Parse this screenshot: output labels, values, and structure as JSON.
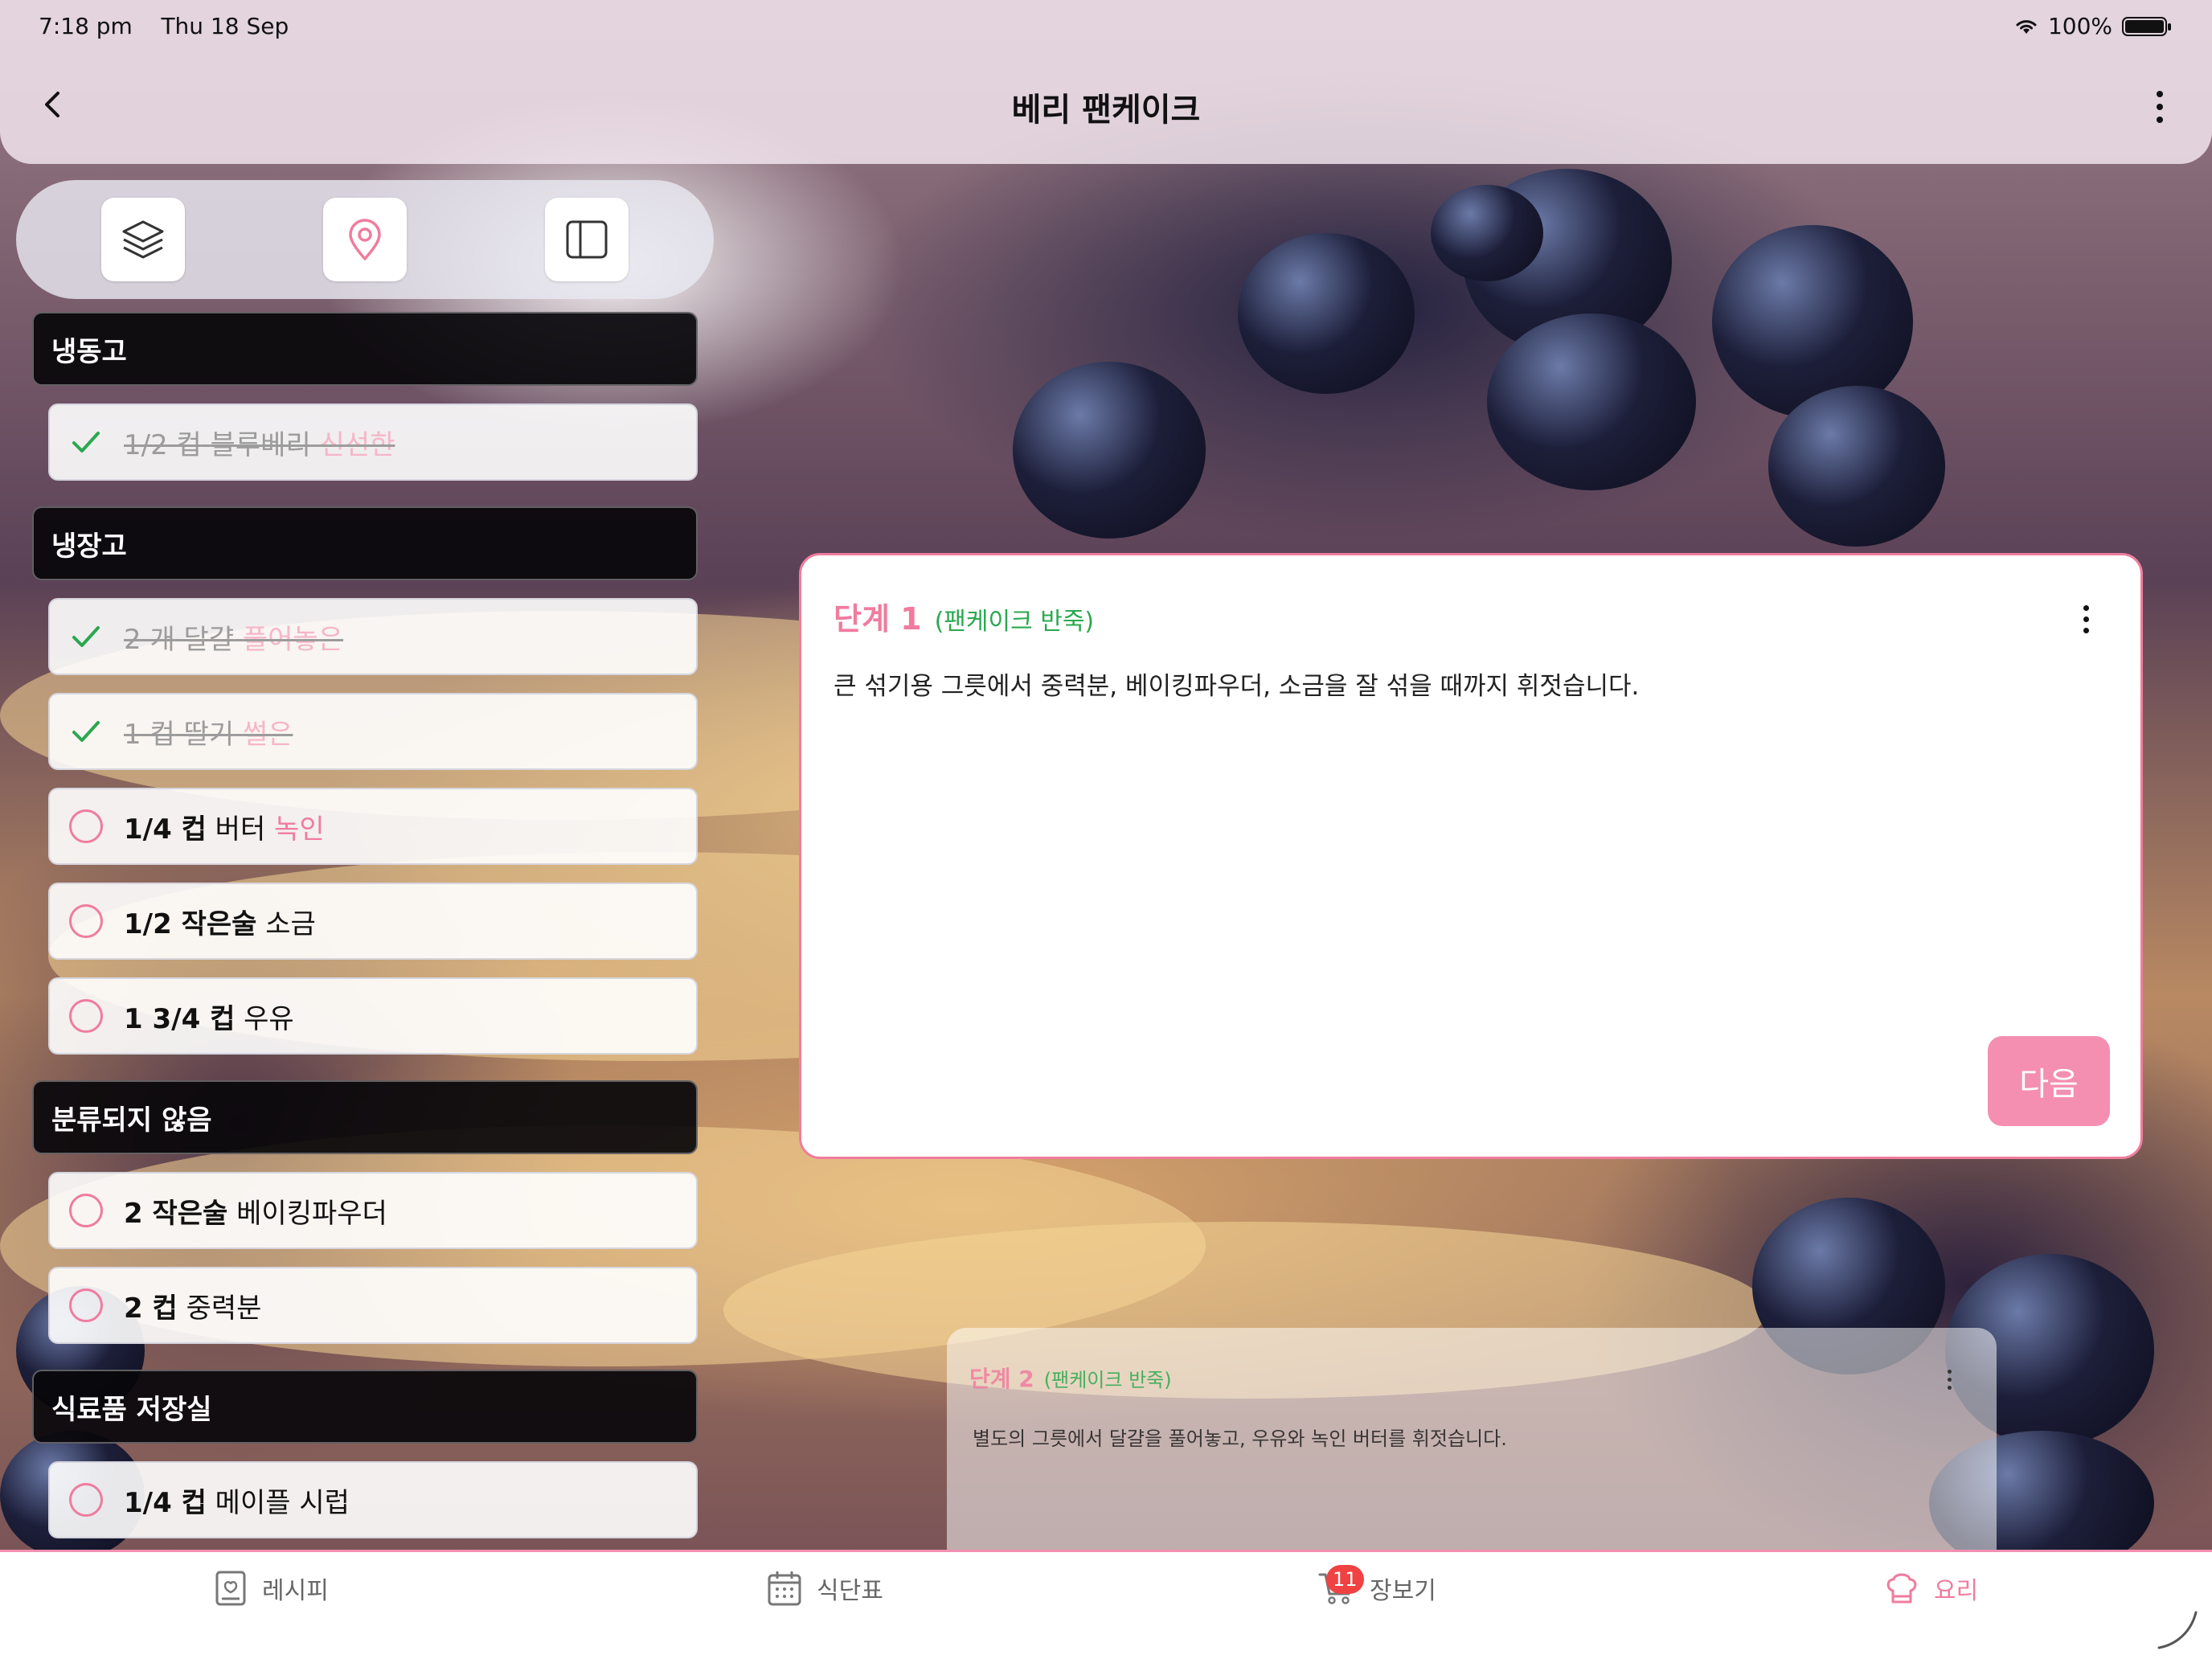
{
  "status_bar": {
    "time": "7:18 pm",
    "date": "Thu 18 Sep",
    "battery": "100%"
  },
  "header": {
    "title": "베리 팬케이크"
  },
  "toolbar": {
    "icons": [
      "layers-icon",
      "location-pin-icon",
      "sidebar-panel-icon"
    ]
  },
  "sections": [
    {
      "title": "냉동고",
      "items": [
        {
          "qty": "1/2 컵",
          "name": "블루베리",
          "note": "신선한",
          "done": true
        }
      ]
    },
    {
      "title": "냉장고",
      "items": [
        {
          "qty": "2 개",
          "name": "달걀",
          "note": "풀어놓은",
          "done": true
        },
        {
          "qty": "1 컵",
          "name": "딸기",
          "note": "썰은",
          "done": true
        },
        {
          "qty": "1/4 컵",
          "name": "버터",
          "note": "녹인",
          "done": false
        },
        {
          "qty": "1/2 작은술",
          "name": "소금",
          "note": "",
          "done": false
        },
        {
          "qty": "1 3/4 컵",
          "name": "우유",
          "note": "",
          "done": false
        }
      ]
    },
    {
      "title": "분류되지 않음",
      "items": [
        {
          "qty": "2 작은술",
          "name": "베이킹파우더",
          "note": "",
          "done": false
        },
        {
          "qty": "2 컵",
          "name": "중력분",
          "note": "",
          "done": false
        }
      ]
    },
    {
      "title": "식료품 저장실",
      "items": [
        {
          "qty": "1/4 컵",
          "name": "메이플 시럽",
          "note": "",
          "done": false
        }
      ]
    }
  ],
  "current_step": {
    "label": "단계 1",
    "subtitle": "(팬케이크 반죽)",
    "text": "큰 섞기용 그릇에서 중력분, 베이킹파우더, 소금을 잘 섞을 때까지 휘젓습니다.",
    "next_label": "다음"
  },
  "next_step": {
    "label": "단계 2",
    "subtitle": "(팬케이크 반죽)",
    "text": "별도의 그릇에서 달걀을 풀어놓고, 우유와 녹인 버터를 휘젓습니다."
  },
  "tabs": [
    {
      "label": "레시피",
      "icon": "recipe-book-icon"
    },
    {
      "label": "식단표",
      "icon": "calendar-icon"
    },
    {
      "label": "장보기",
      "icon": "cart-icon",
      "badge": "11"
    },
    {
      "label": "요리",
      "icon": "chef-hat-icon",
      "active": true
    }
  ],
  "colors": {
    "accent": "#f07c9e",
    "green": "#2aa84f",
    "badge": "#f04242"
  }
}
